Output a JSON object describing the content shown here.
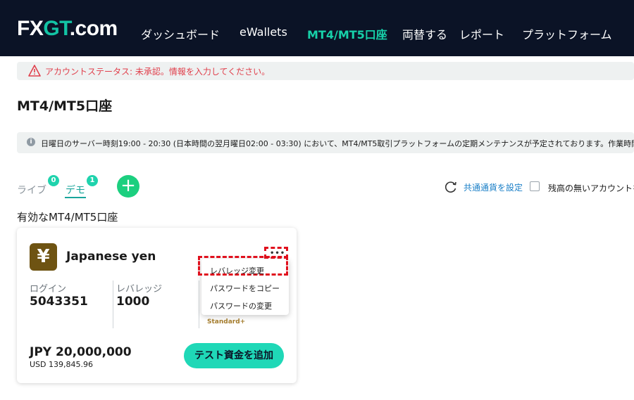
{
  "header": {
    "logo_part1": "FX",
    "logo_part2": "GT",
    "logo_part3": ".com",
    "nav": [
      {
        "label": "ダッシュボード"
      },
      {
        "label": "eWallets"
      },
      {
        "label": "MT4/MT5口座"
      },
      {
        "label": "両替する"
      },
      {
        "label": "レポート"
      },
      {
        "label": "プラットフォーム"
      }
    ]
  },
  "alert": {
    "text": "アカウントステータス: 未承認。情報を入力してください。",
    "icon": "warning-icon",
    "color": "#e0404c"
  },
  "page_title": "MT4/MT5口座",
  "notice": {
    "text": "日曜日のサーバー時刻19:00 - 20:30 (日本時間の翌月曜日02:00 - 03:30) において、MT4/MT5取引プラットフォームの定期メンテナンスが予定されております。作業時間中、M",
    "icon": "info-icon"
  },
  "tabs": {
    "live": {
      "label": "ライブ",
      "count": "0"
    },
    "demo": {
      "label": "デモ",
      "count": "1"
    },
    "add_icon": "plus-icon"
  },
  "toolbar": {
    "currency_link": "共通通貨を設定",
    "checkbox_label": "残高の無いアカウントを"
  },
  "section_title": "有効なMT4/MT5口座",
  "account_card": {
    "currency_symbol": "¥",
    "currency_name": "Japanese yen",
    "login_label": "ログイン",
    "login_value": "5043351",
    "leverage_label": "レバレッジ",
    "leverage_value": "1000",
    "account_type": "Standard+",
    "balance": "JPY 20,000,000",
    "usd_balance": "USD 139,845.96",
    "add_funds_label": "テスト資金を追加",
    "more_icon": "more-horizontal-icon"
  },
  "dropdown_menu": {
    "items": [
      {
        "label": "レバレッジ変更"
      },
      {
        "label": "パスワードをコピー"
      },
      {
        "label": "パスワードの変更"
      }
    ]
  },
  "colors": {
    "header_bg": "#0b1326",
    "accent": "#17d1a9",
    "highlight_border": "#e0101d",
    "add_button": "#1ccf7f"
  }
}
